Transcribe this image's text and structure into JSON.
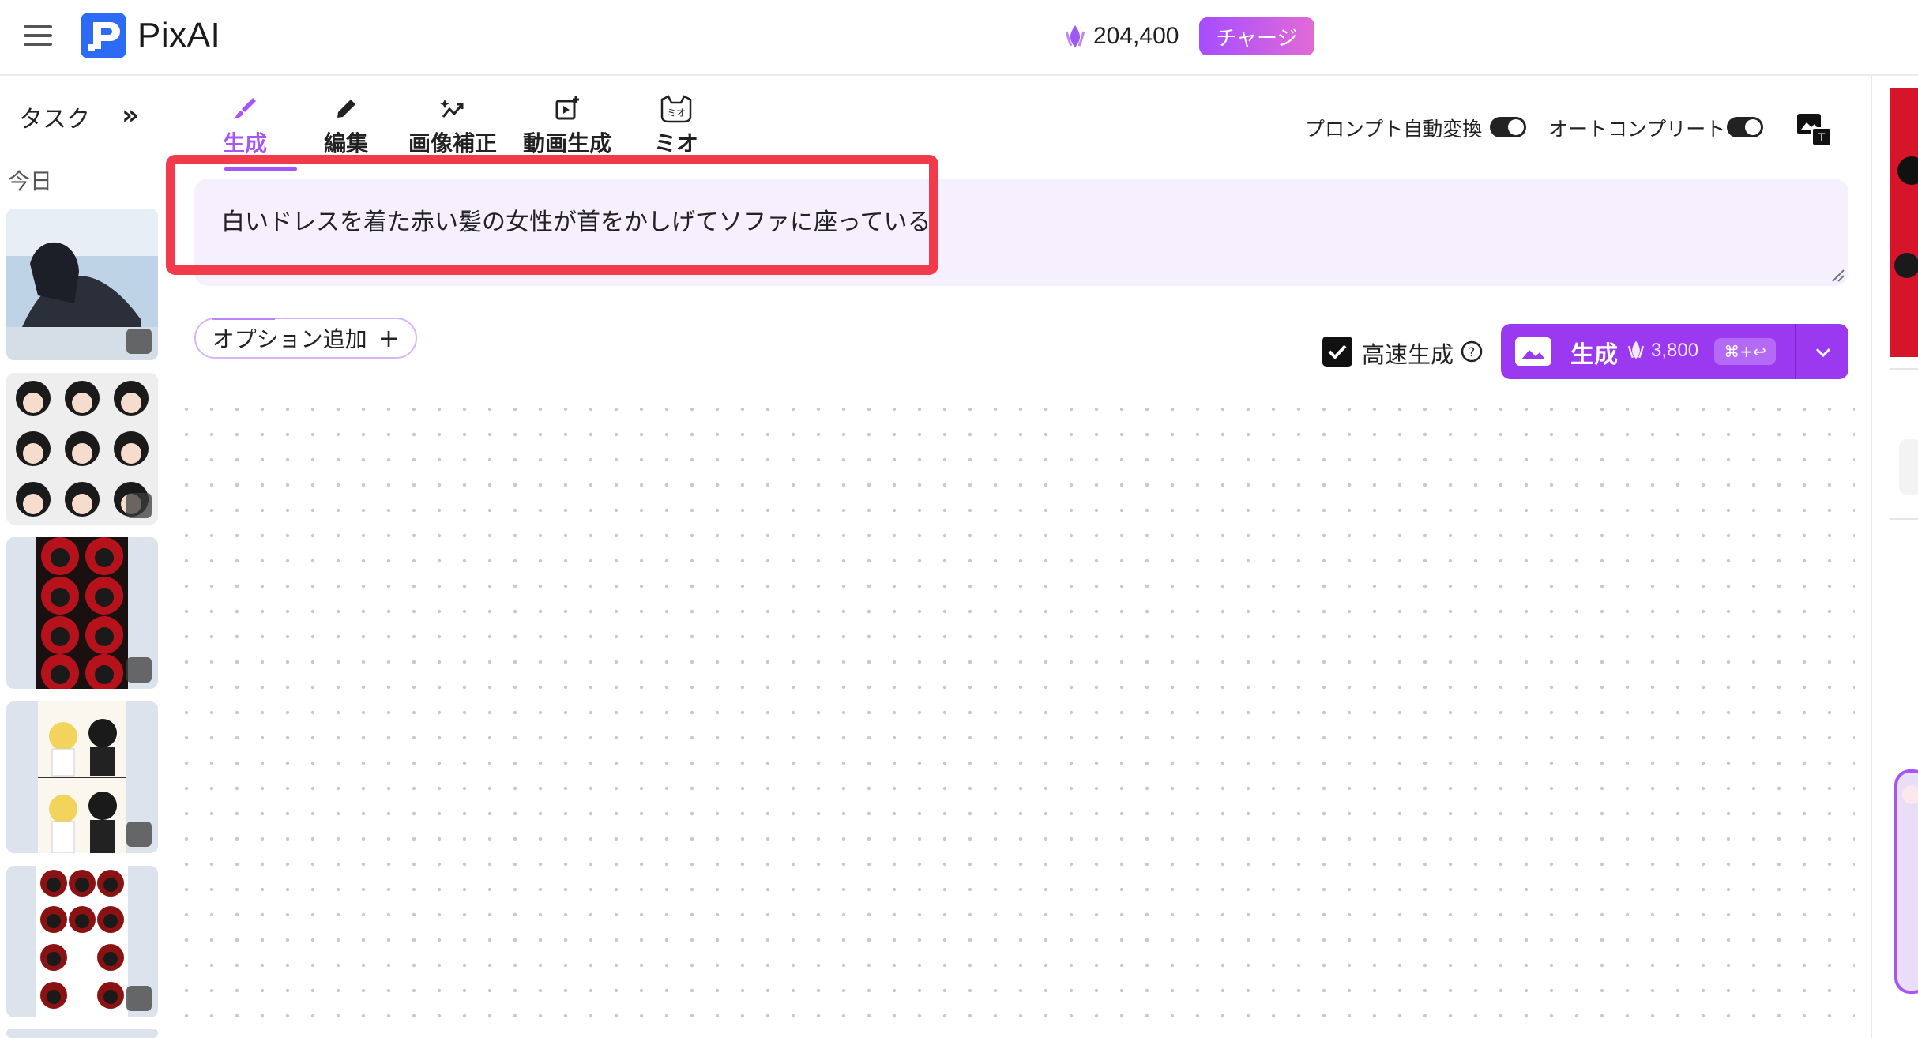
{
  "app": {
    "name": "PixAI"
  },
  "header": {
    "credits": "204,400",
    "charge_label": "チャージ"
  },
  "sidebar": {
    "tasks_label": "タスク",
    "collapse_label": "»",
    "today_label": "今日"
  },
  "tabs": [
    {
      "label": "生成",
      "icon": "brush-icon",
      "active": true
    },
    {
      "label": "編集",
      "icon": "pencil-icon",
      "active": false
    },
    {
      "label": "画像補正",
      "icon": "sparkle-trend-icon",
      "active": false
    },
    {
      "label": "動画生成",
      "icon": "video-plus-icon",
      "active": false
    },
    {
      "label": "ミオ",
      "icon": "cat-face-icon",
      "active": false
    }
  ],
  "settings": {
    "prompt_auto_convert_label": "プロンプト自動変換",
    "prompt_auto_convert_on": true,
    "autocomplete_label": "オートコンプリート",
    "autocomplete_on": true
  },
  "prompt": {
    "text": "白いドレスを着た赤い髪の女性が首をかしげてソファに座っている"
  },
  "options": {
    "add_option_label": "オプション追加"
  },
  "generate": {
    "fast_label": "高速生成",
    "fast_checked": true,
    "button_label": "生成",
    "cost": "3,800",
    "shortcut": "⌘+↩"
  },
  "colors": {
    "accent": "#a855f7",
    "generate_button": "#9b39f0",
    "highlight_frame": "#f23b4a",
    "prompt_bg": "#f6effd"
  }
}
